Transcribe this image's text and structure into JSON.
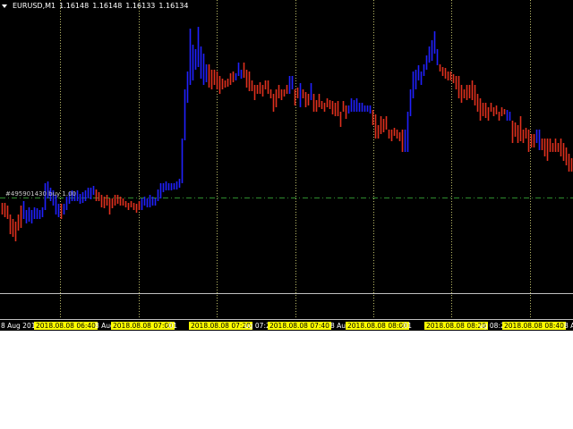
{
  "header": {
    "symbol": "EURUSD,M1",
    "open": "1.16148",
    "high": "1.16148",
    "low": "1.16133",
    "close": "1.16134"
  },
  "order": {
    "label": "#495901430 buy 1.00",
    "price": 1.16104
  },
  "colors": {
    "up": "#2020ff",
    "down": "#e0301e",
    "grid": "#bdbd6a",
    "order_line": "#2e8b2e",
    "background": "#000000"
  },
  "time_axis": {
    "labels": [
      {
        "text": "8 Aug 2018",
        "highlight": false
      },
      {
        "text": "2018.08.08 06:40",
        "highlight": true
      },
      {
        "text": "8 Aug",
        "highlight": false
      },
      {
        "text": "2018.08.08 07:00",
        "highlight": true
      },
      {
        "text": ":01",
        "highlight": false
      },
      {
        "text": "2018.08.08 07:20",
        "highlight": true
      },
      {
        "text": "ug 07:25",
        "highlight": false
      },
      {
        "text": "2018.08.08 07:40",
        "highlight": true
      },
      {
        "text": "8 Aug",
        "highlight": false
      },
      {
        "text": "2018.08.08 08:00",
        "highlight": true
      },
      {
        "text": ":01",
        "highlight": false
      },
      {
        "text": "2018.08.08 08:20",
        "highlight": true
      },
      {
        "text": "ug 08:25",
        "highlight": false
      },
      {
        "text": "2018.08.08 08:40",
        "highlight": true
      },
      {
        "text": "8 A",
        "highlight": false
      }
    ]
  },
  "chart_data": {
    "type": "ohlc-bar",
    "symbol": "EURUSD",
    "timeframe": "M1",
    "price_range": [
      1.15997,
      1.16325
    ],
    "bar_format": [
      "high",
      "low",
      "direction"
    ],
    "bars": [
      [
        1.16098,
        1.16085,
        "d"
      ],
      [
        1.16098,
        1.16082,
        "d"
      ],
      [
        1.16095,
        1.1608,
        "d"
      ],
      [
        1.16085,
        1.16063,
        "d"
      ],
      [
        1.1608,
        1.1606,
        "d"
      ],
      [
        1.16077,
        1.16055,
        "d"
      ],
      [
        1.16085,
        1.16067,
        "d"
      ],
      [
        1.16095,
        1.1607,
        "d"
      ],
      [
        1.161,
        1.1608,
        "u"
      ],
      [
        1.1609,
        1.16075,
        "u"
      ],
      [
        1.16093,
        1.16077,
        "u"
      ],
      [
        1.1609,
        1.16075,
        "u"
      ],
      [
        1.16093,
        1.1608,
        "u"
      ],
      [
        1.16092,
        1.1608,
        "u"
      ],
      [
        1.1609,
        1.1608,
        "u"
      ],
      [
        1.16093,
        1.16082,
        "u"
      ],
      [
        1.1612,
        1.1609,
        "u"
      ],
      [
        1.16122,
        1.16103,
        "u"
      ],
      [
        1.16115,
        1.161,
        "u"
      ],
      [
        1.16112,
        1.16095,
        "u"
      ],
      [
        1.16107,
        1.16085,
        "u"
      ],
      [
        1.16097,
        1.16082,
        "u"
      ],
      [
        1.16097,
        1.1608,
        "d"
      ],
      [
        1.16097,
        1.16085,
        "u"
      ],
      [
        1.16105,
        1.1609,
        "u"
      ],
      [
        1.1611,
        1.16097,
        "u"
      ],
      [
        1.16112,
        1.161,
        "u"
      ],
      [
        1.1611,
        1.161,
        "u"
      ],
      [
        1.16112,
        1.161,
        "u"
      ],
      [
        1.16108,
        1.16097,
        "u"
      ],
      [
        1.1611,
        1.16098,
        "u"
      ],
      [
        1.16112,
        1.161,
        "u"
      ],
      [
        1.16115,
        1.16103,
        "u"
      ],
      [
        1.16115,
        1.16102,
        "u"
      ],
      [
        1.16117,
        1.16107,
        "u"
      ],
      [
        1.16113,
        1.161,
        "d"
      ],
      [
        1.1611,
        1.161,
        "d"
      ],
      [
        1.16107,
        1.16093,
        "d"
      ],
      [
        1.16105,
        1.16092,
        "d"
      ],
      [
        1.16107,
        1.16095,
        "d"
      ],
      [
        1.16103,
        1.16085,
        "d"
      ],
      [
        1.16103,
        1.16092,
        "d"
      ],
      [
        1.16107,
        1.16095,
        "d"
      ],
      [
        1.16107,
        1.16097,
        "d"
      ],
      [
        1.16105,
        1.16095,
        "d"
      ],
      [
        1.16103,
        1.16095,
        "d"
      ],
      [
        1.161,
        1.16093,
        "d"
      ],
      [
        1.16098,
        1.1609,
        "d"
      ],
      [
        1.161,
        1.16093,
        "d"
      ],
      [
        1.16098,
        1.1609,
        "d"
      ],
      [
        1.16097,
        1.16087,
        "d"
      ],
      [
        1.161,
        1.1609,
        "d"
      ],
      [
        1.16103,
        1.1609,
        "u"
      ],
      [
        1.16105,
        1.16095,
        "u"
      ],
      [
        1.16103,
        1.16093,
        "u"
      ],
      [
        1.16107,
        1.16093,
        "u"
      ],
      [
        1.16105,
        1.16095,
        "u"
      ],
      [
        1.16103,
        1.16095,
        "u"
      ],
      [
        1.16113,
        1.161,
        "u"
      ],
      [
        1.1612,
        1.16103,
        "u"
      ],
      [
        1.1612,
        1.1611,
        "u"
      ],
      [
        1.16122,
        1.16112,
        "u"
      ],
      [
        1.1612,
        1.16112,
        "u"
      ],
      [
        1.1612,
        1.16112,
        "u"
      ],
      [
        1.1612,
        1.16113,
        "u"
      ],
      [
        1.16122,
        1.16113,
        "u"
      ],
      [
        1.16125,
        1.16115,
        "u"
      ],
      [
        1.1617,
        1.1612,
        "u"
      ],
      [
        1.16225,
        1.16168,
        "u"
      ],
      [
        1.16245,
        1.1621,
        "u"
      ],
      [
        1.16293,
        1.1623,
        "u"
      ],
      [
        1.16275,
        1.16235,
        "u"
      ],
      [
        1.1627,
        1.16247,
        "u"
      ],
      [
        1.16295,
        1.1625,
        "u"
      ],
      [
        1.16273,
        1.16237,
        "u"
      ],
      [
        1.16265,
        1.1623,
        "u"
      ],
      [
        1.16253,
        1.16233,
        "u"
      ],
      [
        1.16253,
        1.16227,
        "d"
      ],
      [
        1.16247,
        1.16225,
        "d"
      ],
      [
        1.16247,
        1.1623,
        "d"
      ],
      [
        1.16245,
        1.16225,
        "d"
      ],
      [
        1.1624,
        1.1622,
        "d"
      ],
      [
        1.16237,
        1.16225,
        "d"
      ],
      [
        1.16235,
        1.16227,
        "d"
      ],
      [
        1.16237,
        1.16228,
        "d"
      ],
      [
        1.16243,
        1.1623,
        "d"
      ],
      [
        1.16245,
        1.16233,
        "d"
      ],
      [
        1.16243,
        1.16235,
        "u"
      ],
      [
        1.16255,
        1.1624,
        "u"
      ],
      [
        1.16247,
        1.16237,
        "u"
      ],
      [
        1.16255,
        1.16238,
        "d"
      ],
      [
        1.16247,
        1.16227,
        "d"
      ],
      [
        1.16245,
        1.16223,
        "d"
      ],
      [
        1.16235,
        1.16223,
        "d"
      ],
      [
        1.1623,
        1.16213,
        "d"
      ],
      [
        1.1623,
        1.1622,
        "d"
      ],
      [
        1.16233,
        1.1622,
        "d"
      ],
      [
        1.1623,
        1.16217,
        "d"
      ],
      [
        1.16235,
        1.16225,
        "d"
      ],
      [
        1.16235,
        1.1622,
        "d"
      ],
      [
        1.16225,
        1.16215,
        "d"
      ],
      [
        1.1622,
        1.162,
        "d"
      ],
      [
        1.16225,
        1.16205,
        "d"
      ],
      [
        1.1623,
        1.16215,
        "d"
      ],
      [
        1.16225,
        1.16213,
        "d"
      ],
      [
        1.16225,
        1.16217,
        "d"
      ],
      [
        1.1623,
        1.1622,
        "d"
      ],
      [
        1.1624,
        1.1622,
        "u"
      ],
      [
        1.1624,
        1.16225,
        "u"
      ],
      [
        1.16225,
        1.16207,
        "d"
      ],
      [
        1.16227,
        1.16215,
        "d"
      ],
      [
        1.16232,
        1.16205,
        "u"
      ],
      [
        1.16225,
        1.16215,
        "d"
      ],
      [
        1.16222,
        1.16205,
        "d"
      ],
      [
        1.1622,
        1.16207,
        "d"
      ],
      [
        1.16232,
        1.16213,
        "u"
      ],
      [
        1.1622,
        1.162,
        "d"
      ],
      [
        1.16213,
        1.162,
        "d"
      ],
      [
        1.1622,
        1.16205,
        "d"
      ],
      [
        1.16212,
        1.16203,
        "d"
      ],
      [
        1.1621,
        1.162,
        "d"
      ],
      [
        1.16215,
        1.16205,
        "d"
      ],
      [
        1.16213,
        1.16203,
        "d"
      ],
      [
        1.16212,
        1.16197,
        "d"
      ],
      [
        1.1621,
        1.16195,
        "d"
      ],
      [
        1.16212,
        1.16195,
        "d"
      ],
      [
        1.162,
        1.16183,
        "d"
      ],
      [
        1.16212,
        1.162,
        "d"
      ],
      [
        1.16207,
        1.16192,
        "d"
      ],
      [
        1.16207,
        1.16198,
        "u"
      ],
      [
        1.16215,
        1.162,
        "u"
      ],
      [
        1.16213,
        1.162,
        "u"
      ],
      [
        1.16215,
        1.162,
        "u"
      ],
      [
        1.1621,
        1.162,
        "u"
      ],
      [
        1.1621,
        1.162,
        "u"
      ],
      [
        1.16207,
        1.162,
        "u"
      ],
      [
        1.16207,
        1.162,
        "u"
      ],
      [
        1.16207,
        1.16198,
        "u"
      ],
      [
        1.16202,
        1.16185,
        "d"
      ],
      [
        1.16197,
        1.1617,
        "d"
      ],
      [
        1.16185,
        1.1617,
        "d"
      ],
      [
        1.16195,
        1.16175,
        "d"
      ],
      [
        1.16192,
        1.16177,
        "d"
      ],
      [
        1.16195,
        1.1618,
        "d"
      ],
      [
        1.1618,
        1.1617,
        "d"
      ],
      [
        1.1618,
        1.16167,
        "d"
      ],
      [
        1.16182,
        1.16173,
        "d"
      ],
      [
        1.1618,
        1.1617,
        "d"
      ],
      [
        1.16177,
        1.16167,
        "d"
      ],
      [
        1.1618,
        1.16155,
        "d"
      ],
      [
        1.1618,
        1.16155,
        "u"
      ],
      [
        1.162,
        1.16155,
        "u"
      ],
      [
        1.16225,
        1.16195,
        "u"
      ],
      [
        1.16245,
        1.16215,
        "u"
      ],
      [
        1.16247,
        1.16225,
        "u"
      ],
      [
        1.16252,
        1.16235,
        "u"
      ],
      [
        1.16245,
        1.1623,
        "u"
      ],
      [
        1.16253,
        1.1624,
        "u"
      ],
      [
        1.16263,
        1.16247,
        "u"
      ],
      [
        1.16273,
        1.16255,
        "u"
      ],
      [
        1.1628,
        1.16257,
        "u"
      ],
      [
        1.1629,
        1.16265,
        "u"
      ],
      [
        1.1627,
        1.16252,
        "u"
      ],
      [
        1.16253,
        1.16245,
        "d"
      ],
      [
        1.1625,
        1.1624,
        "d"
      ],
      [
        1.16249,
        1.16237,
        "d"
      ],
      [
        1.16245,
        1.16235,
        "d"
      ],
      [
        1.16245,
        1.16235,
        "d"
      ],
      [
        1.16242,
        1.16232,
        "d"
      ],
      [
        1.1624,
        1.16225,
        "d"
      ],
      [
        1.1624,
        1.16215,
        "d"
      ],
      [
        1.1623,
        1.1621,
        "d"
      ],
      [
        1.16225,
        1.16215,
        "d"
      ],
      [
        1.1623,
        1.16213,
        "d"
      ],
      [
        1.1623,
        1.16215,
        "d"
      ],
      [
        1.16235,
        1.16213,
        "d"
      ],
      [
        1.1623,
        1.16207,
        "d"
      ],
      [
        1.1622,
        1.162,
        "d"
      ],
      [
        1.16215,
        1.1619,
        "d"
      ],
      [
        1.1621,
        1.16195,
        "d"
      ],
      [
        1.1621,
        1.16193,
        "d"
      ],
      [
        1.16205,
        1.1619,
        "d"
      ],
      [
        1.1621,
        1.162,
        "d"
      ],
      [
        1.16205,
        1.16195,
        "d"
      ],
      [
        1.16207,
        1.16197,
        "d"
      ],
      [
        1.162,
        1.1619,
        "d"
      ],
      [
        1.16205,
        1.16195,
        "d"
      ],
      [
        1.16203,
        1.16197,
        "d"
      ],
      [
        1.16202,
        1.1619,
        "u"
      ],
      [
        1.162,
        1.1619,
        "u"
      ],
      [
        1.1619,
        1.16165,
        "d"
      ],
      [
        1.16188,
        1.16172,
        "d"
      ],
      [
        1.16185,
        1.16165,
        "d"
      ],
      [
        1.16195,
        1.16167,
        "d"
      ],
      [
        1.1618,
        1.16165,
        "d"
      ],
      [
        1.16182,
        1.1617,
        "d"
      ],
      [
        1.1618,
        1.16155,
        "d"
      ],
      [
        1.16175,
        1.1616,
        "d"
      ],
      [
        1.16175,
        1.1616,
        "d"
      ],
      [
        1.1618,
        1.16165,
        "u"
      ],
      [
        1.1618,
        1.16157,
        "u"
      ],
      [
        1.1617,
        1.16157,
        "d"
      ],
      [
        1.1617,
        1.1615,
        "d"
      ],
      [
        1.1617,
        1.16145,
        "d"
      ],
      [
        1.1617,
        1.16155,
        "d"
      ],
      [
        1.16165,
        1.16155,
        "d"
      ],
      [
        1.1617,
        1.16155,
        "d"
      ],
      [
        1.16165,
        1.16155,
        "d"
      ],
      [
        1.1617,
        1.1615,
        "d"
      ],
      [
        1.16165,
        1.16145,
        "d"
      ],
      [
        1.1616,
        1.1614,
        "d"
      ],
      [
        1.16153,
        1.16133,
        "d"
      ],
      [
        1.16148,
        1.16133,
        "d"
      ]
    ]
  }
}
